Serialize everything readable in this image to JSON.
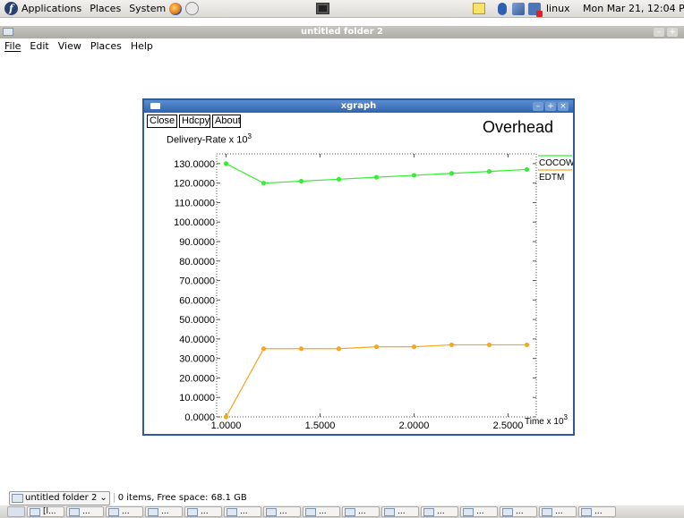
{
  "top_panel": {
    "menus": [
      "Applications",
      "Places",
      "System"
    ],
    "user": "linux",
    "clock": "Mon Mar 21, 12:04 PM"
  },
  "nautilus": {
    "title": "untitled folder 2",
    "menus": [
      "File",
      "Edit",
      "View",
      "Places",
      "Help"
    ]
  },
  "xgraph": {
    "title": "xgraph",
    "buttons": [
      "Close",
      "Hdcpy",
      "About"
    ],
    "graph_title": "Overhead",
    "ylabel": "Delivery-Rate x 10",
    "ylabel_exp": "3",
    "xlabel": "Time x 10",
    "xlabel_exp": "3"
  },
  "chart_data": {
    "type": "line",
    "title": "Overhead",
    "xlabel": "Time x 10^3",
    "ylabel": "Delivery-Rate x 10^3",
    "xlim": [
      0.95,
      2.65
    ],
    "ylim": [
      0,
      135
    ],
    "x_ticks": [
      "1.0000",
      "1.5000",
      "2.0000",
      "2.5000"
    ],
    "y_ticks": [
      "0.0000",
      "10.0000",
      "20.0000",
      "30.0000",
      "40.0000",
      "50.0000",
      "60.0000",
      "70.0000",
      "80.0000",
      "90.0000",
      "100.0000",
      "110.0000",
      "120.0000",
      "130.0000"
    ],
    "legend_position": "top-right",
    "series": [
      {
        "name": "COCOW",
        "color": "#33ee33",
        "x": [
          1.0,
          1.2,
          1.4,
          1.6,
          1.8,
          2.0,
          2.2,
          2.4,
          2.6
        ],
        "y": [
          130,
          120,
          121,
          122,
          123,
          124,
          125,
          126,
          127
        ]
      },
      {
        "name": "EDTM",
        "color": "#f5a623",
        "x": [
          1.0,
          1.2,
          1.4,
          1.6,
          1.8,
          2.0,
          2.2,
          2.4,
          2.6
        ],
        "y": [
          0,
          35,
          35,
          35,
          36,
          36,
          37,
          37,
          37
        ]
      }
    ]
  },
  "statusbar": {
    "location": "untitled folder 2",
    "status": "0 items, Free space: 68.1 GB"
  },
  "taskbar": {
    "items": [
      "[l...",
      "...",
      "...",
      "...",
      "...",
      "...",
      "...",
      "...",
      "...",
      "...",
      "...",
      "...",
      "...",
      "...",
      "..."
    ]
  }
}
